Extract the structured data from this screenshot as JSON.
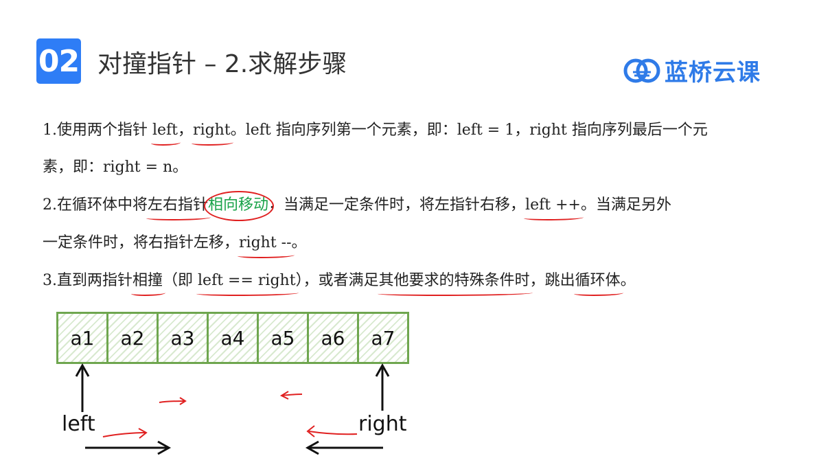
{
  "header": {
    "badge": "02",
    "title": "对撞指针 – 2.求解步骤",
    "logo_text": "蓝桥云课"
  },
  "steps": [
    {
      "line1": [
        "1.使用两个指针 ",
        "left",
        "，",
        "right",
        "。",
        "left 指向序列第一个元素，即：left = 1，right 指向序列最后一个元"
      ],
      "line2": "素，即：right = n。"
    },
    {
      "line1": [
        "2.在循环体中将",
        "左右指针",
        "相向移动",
        "，当满足一定条件时，将左指针右移，",
        "left ++",
        "。当满足另外"
      ],
      "line2": [
        "一定条件时，将右指针左移，",
        "right --",
        "。"
      ]
    },
    {
      "line1": [
        "3.直到两指针",
        "相撞",
        "（即 ",
        "left == right",
        "），或者满足",
        "其他要求的特殊条件时",
        "，跳出",
        "循环体",
        "。"
      ]
    }
  ],
  "diagram": {
    "cells": [
      "a1",
      "a2",
      "a3",
      "a4",
      "a5",
      "a6",
      "a7"
    ],
    "left_label": "left",
    "right_label": "right",
    "colors": {
      "cell_border": "#6fa64f",
      "annotation": "#e02020",
      "highlight": "#1aa34a",
      "badge": "#2e7df6"
    }
  }
}
